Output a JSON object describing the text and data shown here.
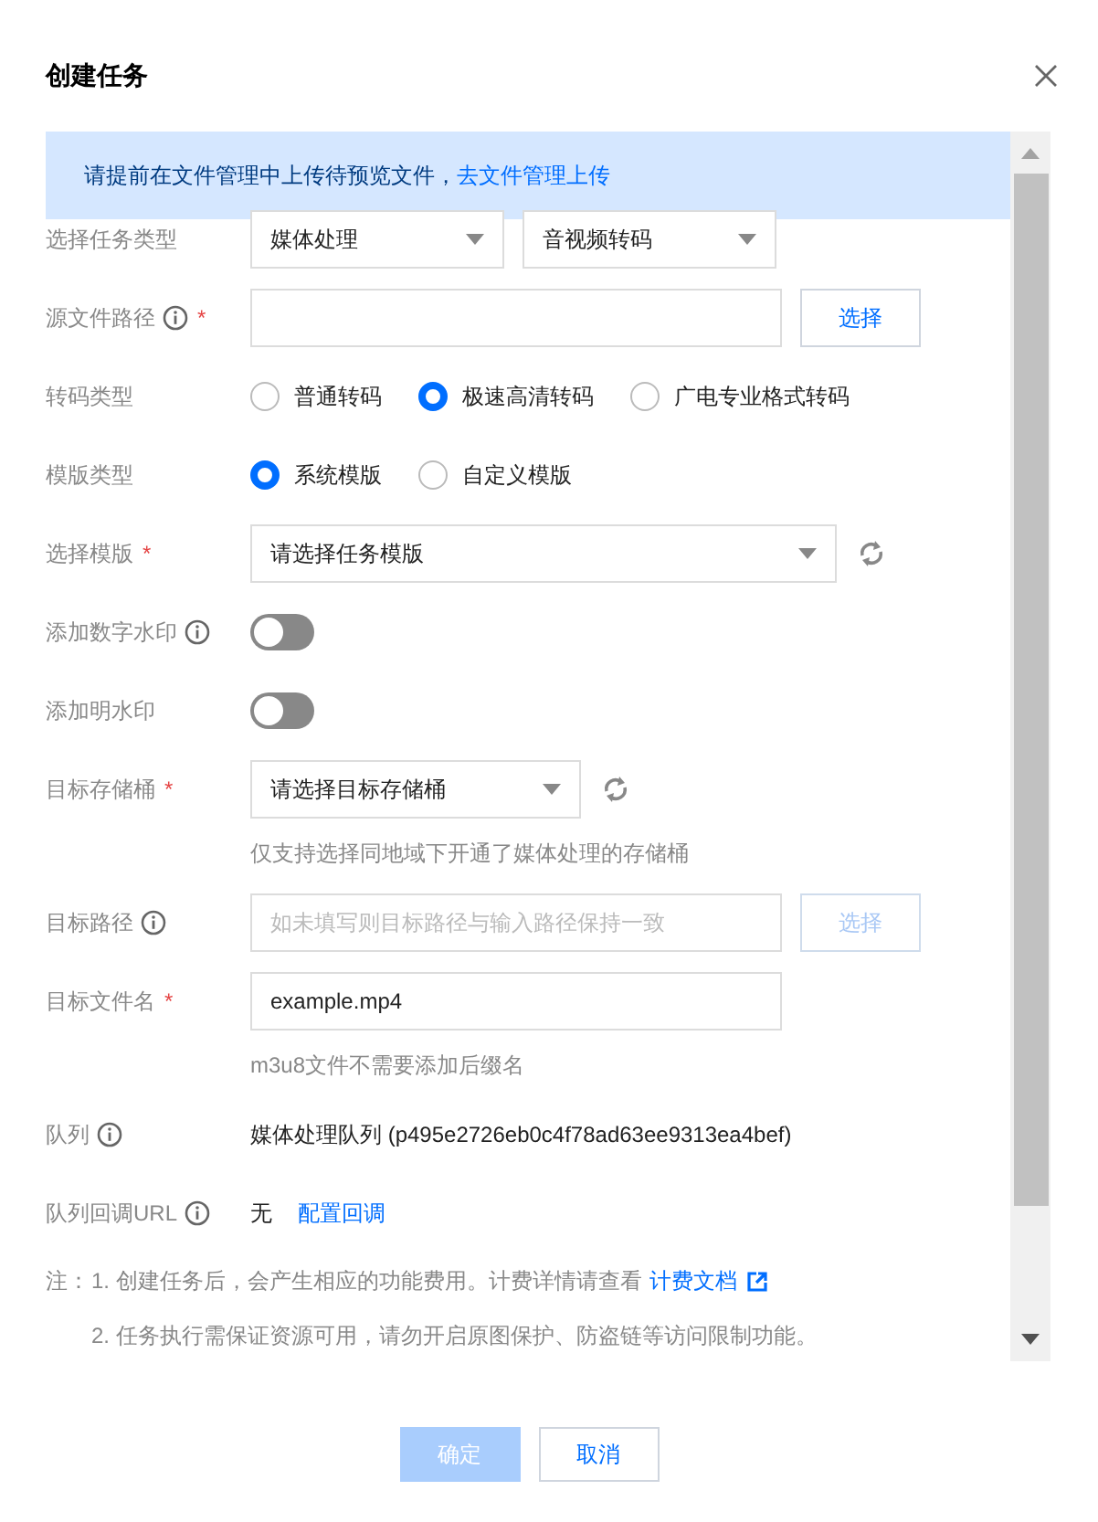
{
  "dialog": {
    "title": "创建任务"
  },
  "notice": {
    "text": "请提前在文件管理中上传待预览文件，",
    "link": "去文件管理上传"
  },
  "fields": [
    {
      "kind": "selects",
      "label": "选择任务类型",
      "selects": [
        {
          "value": "媒体处理"
        },
        {
          "value": "音视频转码"
        }
      ]
    },
    {
      "kind": "picker",
      "label": "源文件路径",
      "info": true,
      "required_mark": "*",
      "button": "选择",
      "disabled": false
    },
    {
      "kind": "radios",
      "label": "转码类型",
      "options": [
        {
          "label": "普通转码",
          "selected": false
        },
        {
          "label": "极速高清转码",
          "selected": true
        },
        {
          "label": "广电专业格式转码",
          "selected": false
        }
      ]
    },
    {
      "kind": "radios",
      "label": "模版类型",
      "options": [
        {
          "label": "系统模版",
          "selected": true
        },
        {
          "label": "自定义模版",
          "selected": false
        }
      ]
    },
    {
      "kind": "wide_select",
      "label": "选择模版",
      "required_mark": "*",
      "value": "请选择任务模版",
      "refresh": true
    },
    {
      "kind": "toggle",
      "label": "添加数字水印",
      "info": true,
      "on": false
    },
    {
      "kind": "toggle",
      "label": "添加明水印",
      "on": false
    },
    {
      "kind": "select",
      "label": "目标存储桶",
      "required_mark": "*",
      "value": "请选择目标存储桶",
      "refresh": true,
      "hint": "仅支持选择同地域下开通了媒体处理的存储桶"
    },
    {
      "kind": "picker",
      "label": "目标路径",
      "info": true,
      "placeholder": "如未填写则目标路径与输入路径保持一致",
      "button": "选择",
      "disabled": true
    },
    {
      "kind": "input",
      "label": "目标文件名",
      "required_mark": "*",
      "value": "example.mp4",
      "hint": "m3u8文件不需要添加后缀名"
    },
    {
      "kind": "text",
      "label": "队列",
      "info": true,
      "value": "媒体处理队列 (p495e2726eb0c4f78ad63ee9313ea4bef)"
    },
    {
      "kind": "text",
      "label": "队列回调URL",
      "info": true,
      "value": "无",
      "link": "配置回调"
    }
  ],
  "notes": {
    "label": "注：",
    "items": [
      {
        "text": "1. 创建任务后，会产生相应的功能费用。计费详情请查看",
        "link": "计费文档"
      },
      {
        "text": "2. 任务执行需保证资源可用，请勿开启原图保护、防盗链等访问限制功能。"
      }
    ]
  },
  "buttons": [
    {
      "label": "确定",
      "kind": "primary",
      "disabled": true
    },
    {
      "label": "取消",
      "kind": "default",
      "disabled": false
    }
  ]
}
